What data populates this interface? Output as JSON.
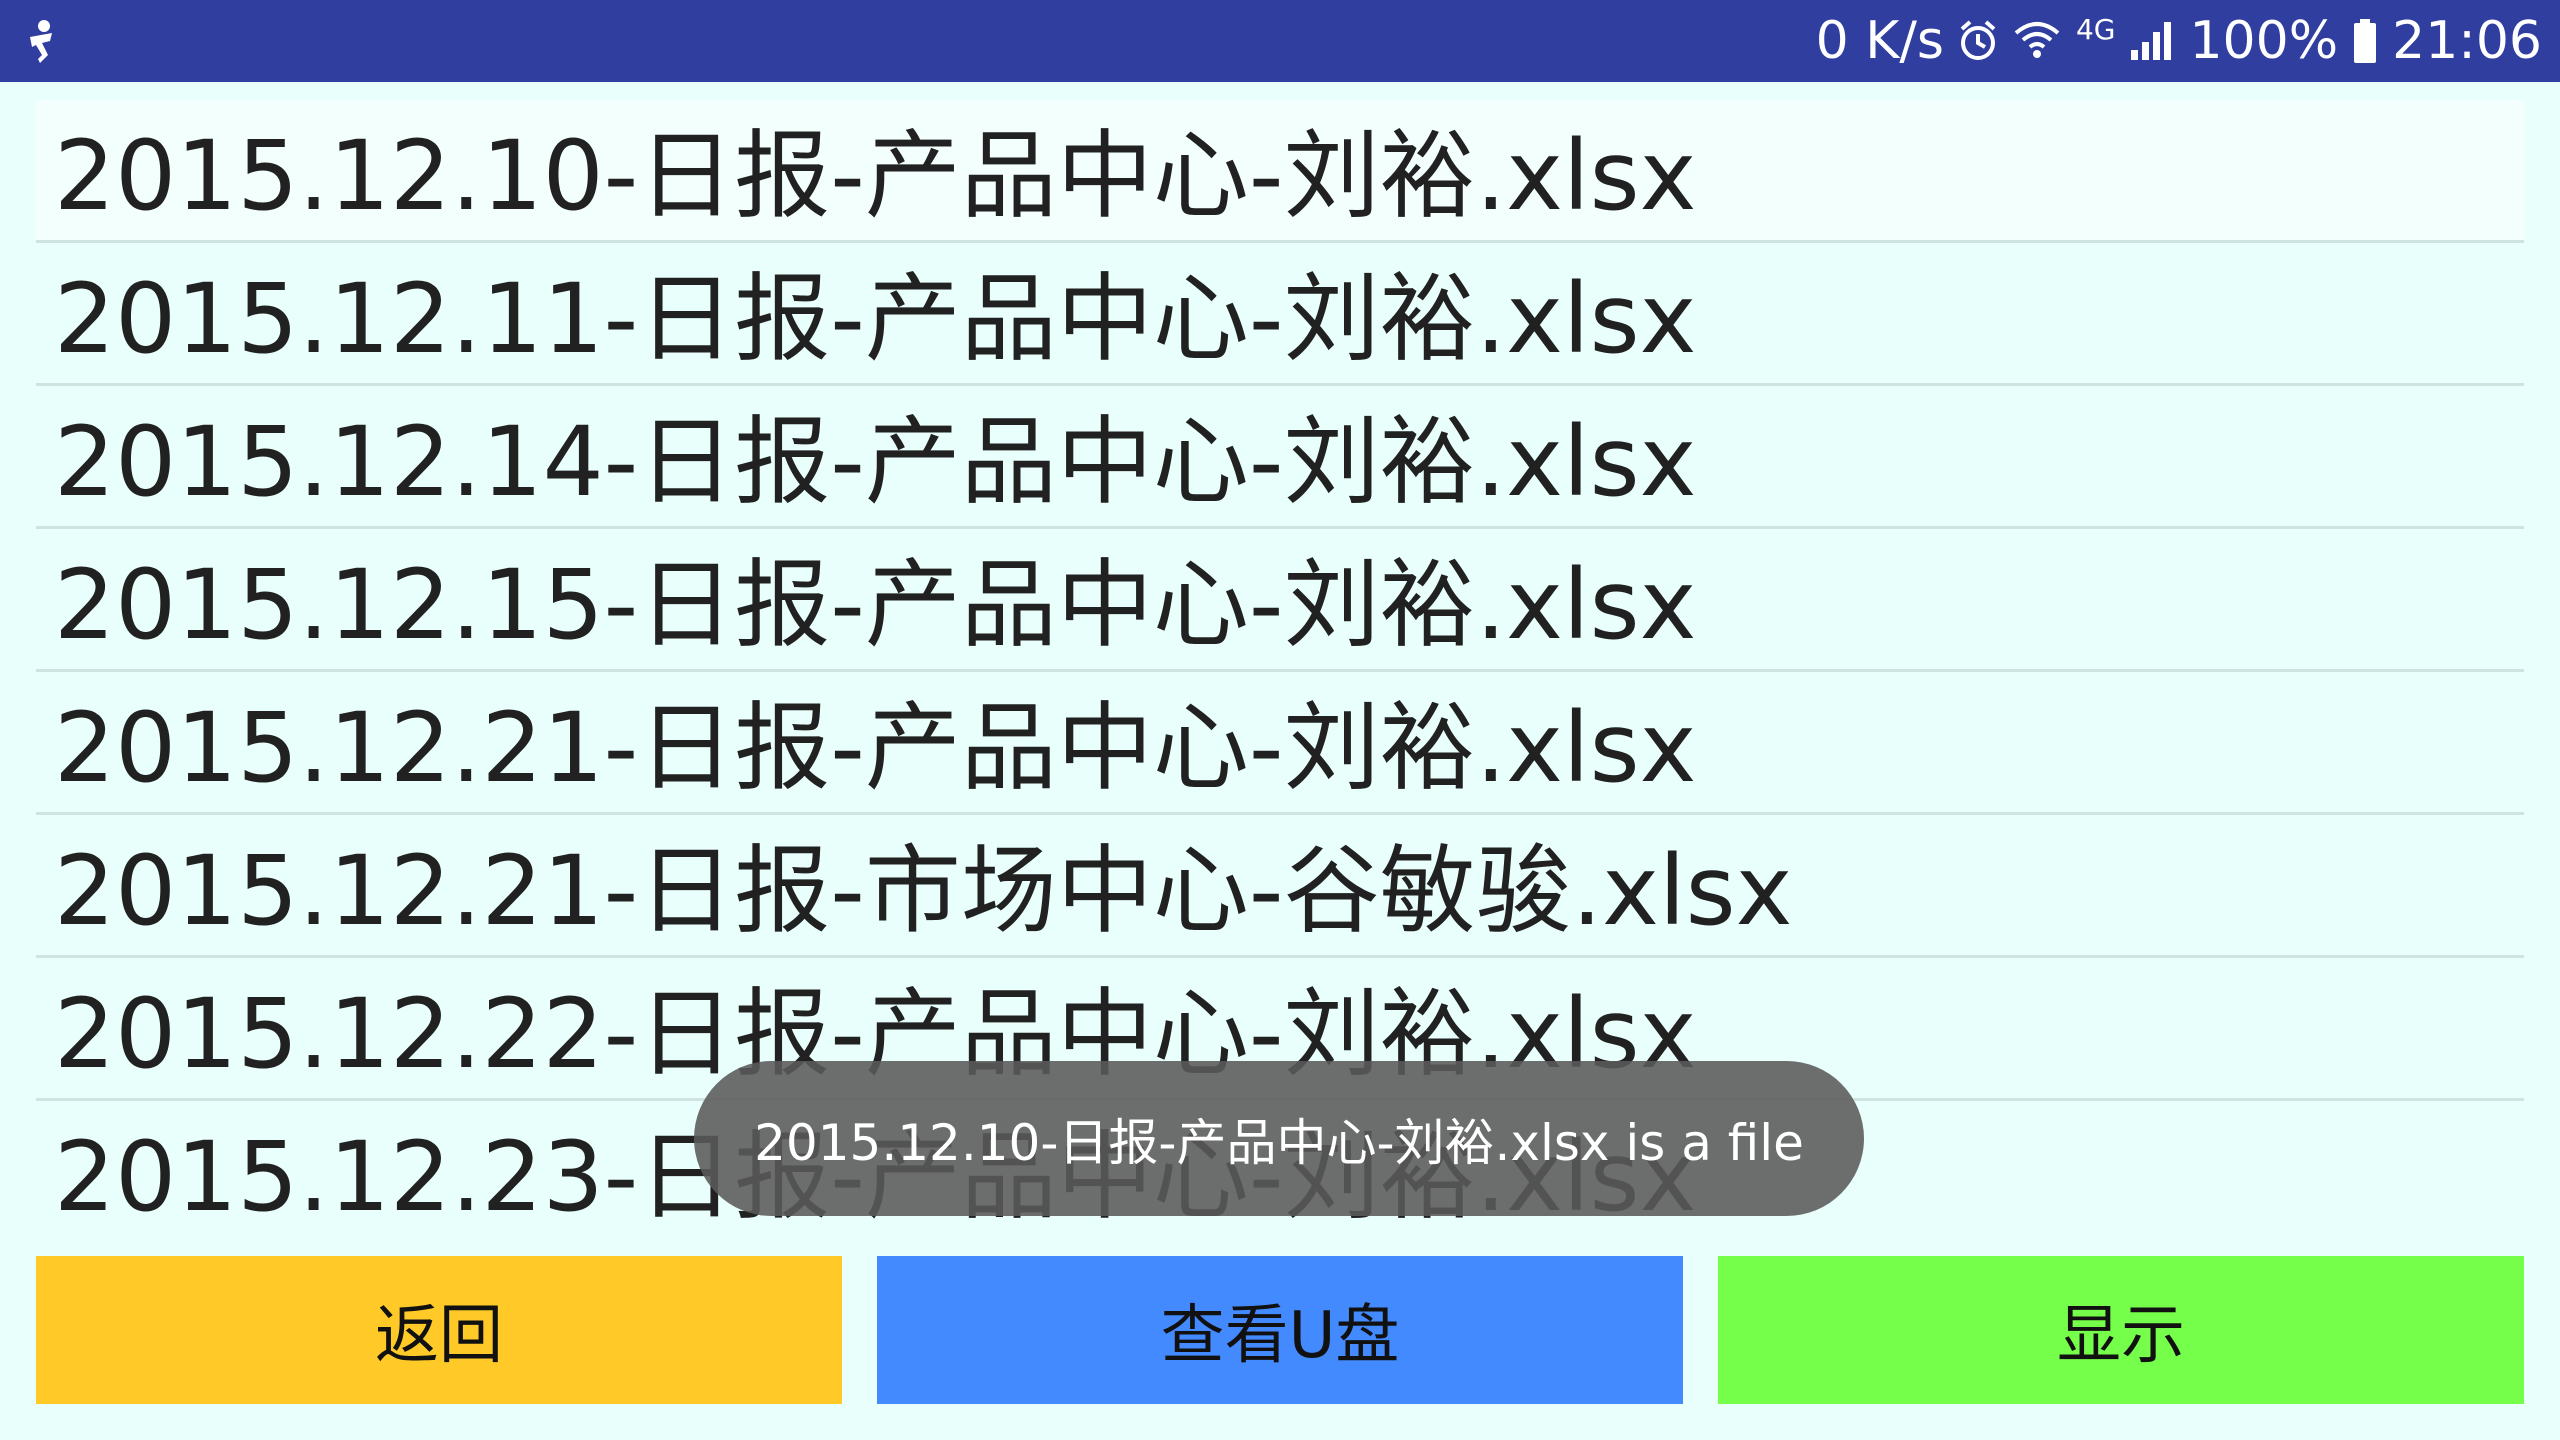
{
  "status_bar": {
    "net_speed": "0 K/s",
    "network_type": "4G",
    "battery": "100%",
    "time": "21:06",
    "icons": [
      "usb-debug-icon",
      "alarm-icon",
      "wifi-icon",
      "signal-icon",
      "battery-icon"
    ],
    "background_color": "#303f9f"
  },
  "file_list": {
    "items": [
      "2015.12.10-日报-产品中心-刘裕.xlsx",
      "2015.12.11-日报-产品中心-刘裕.xlsx",
      "2015.12.14-日报-产品中心-刘裕.xlsx",
      "2015.12.15-日报-产品中心-刘裕.xlsx",
      "2015.12.21-日报-产品中心-刘裕.xlsx",
      "2015.12.21-日报-市场中心-谷敏骏.xlsx",
      "2015.12.22-日报-产品中心-刘裕.xlsx",
      "2015.12.23-日报-产品中心-刘裕.xlsx"
    ]
  },
  "toast": {
    "message": "2015.12.10-日报-产品中心-刘裕.xlsx is a file"
  },
  "buttons": {
    "back_label": "返回",
    "back_color": "#ffca28",
    "view_usb_label": "查看U盘",
    "view_usb_color": "#448aff",
    "show_label": "显示",
    "show_color": "#76ff4a"
  }
}
